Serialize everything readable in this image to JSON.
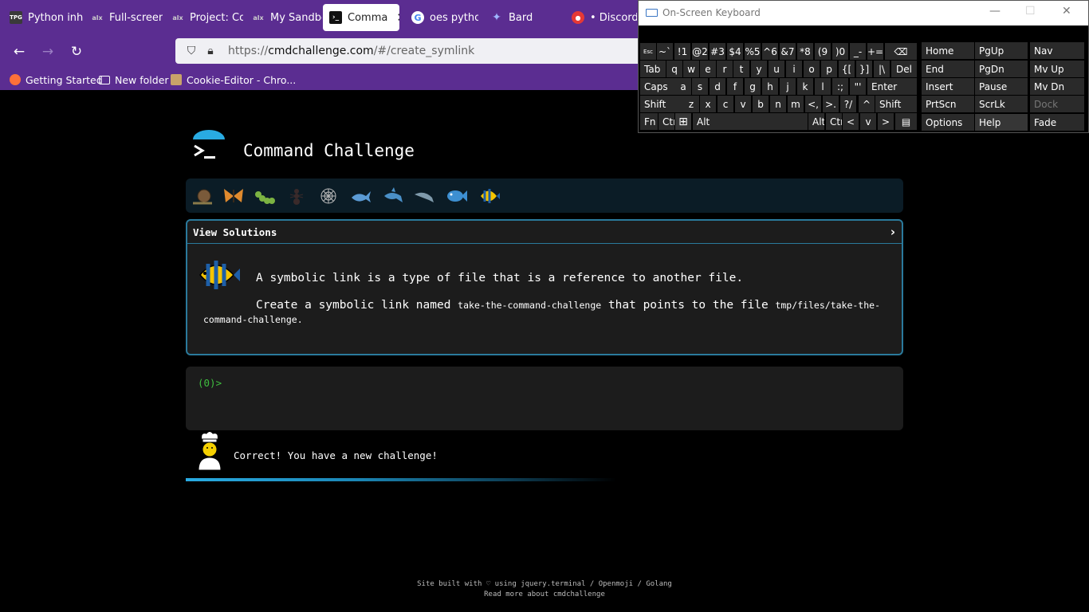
{
  "browser": {
    "tabs": [
      {
        "label": "Python inh",
        "favicon": "TPG"
      },
      {
        "label": "Full-screen",
        "favicon": "alx"
      },
      {
        "label": "Project: Co",
        "favicon": "alx"
      },
      {
        "label": "My Sandbo",
        "favicon": "alx"
      },
      {
        "label": "Comma",
        "favicon": "terminal-icon",
        "active": true,
        "close": "✕"
      },
      {
        "label": "oes python",
        "favicon": "google-icon"
      },
      {
        "label": "Bard",
        "favicon": "bard-icon"
      },
      {
        "label": "• Discord |",
        "favicon": "discord-icon"
      }
    ],
    "url": {
      "scheme": "https://",
      "host": "cmdchallenge.com",
      "path": "/#/create_symlink"
    },
    "bookmarks": [
      "Getting Started",
      "New folder",
      "Cookie-Editor - Chro..."
    ]
  },
  "page": {
    "site_title": "Command Challenge",
    "badges": [
      "snail",
      "butterfly",
      "caterpillar",
      "ant",
      "spider-web",
      "whale",
      "shark",
      "dolphin",
      "fish",
      "tropical-fish"
    ],
    "panel": {
      "header": "View Solutions",
      "arrow": "›",
      "description": "A symbolic link is a type of file that is a reference to another file.",
      "task_prefix": "Create a symbolic link named",
      "task_name": "take-the-command-challenge",
      "task_middle": "that points to the file",
      "task_target": "tmp/files/take-the-command-challenge",
      "task_suffix": "."
    },
    "terminal": {
      "prompt": "(0)>"
    },
    "feedback": "Correct! You have a new challenge!",
    "footer": {
      "line1": "Site built with ♡ using jquery.terminal / Openmoji / Golang",
      "line2": "Read more about cmdchallenge"
    }
  },
  "osk": {
    "title": "On-Screen Keyboard",
    "rows": [
      [
        "Esc",
        "~`",
        "!1",
        "@2",
        "#3",
        "$4",
        "%5",
        "^6",
        "&7",
        "*8",
        "(9",
        ")0",
        "_-",
        "+=",
        "⌫"
      ],
      [
        "Tab",
        "q",
        "w",
        "e",
        "r",
        "t",
        "y",
        "u",
        "i",
        "o",
        "p",
        "{[",
        "}]",
        "|\\",
        "Del"
      ],
      [
        "Caps",
        "a",
        "s",
        "d",
        "f",
        "g",
        "h",
        "j",
        "k",
        "l",
        ":;",
        "\"'",
        "Enter"
      ],
      [
        "Shift",
        "z",
        "x",
        "c",
        "v",
        "b",
        "n",
        "m",
        "<,",
        ">.",
        "?/",
        "^",
        "Shift"
      ],
      [
        "Fn",
        "Ctrl",
        "⊞",
        "Alt",
        "",
        "Alt",
        "Ctrl",
        "<",
        "v",
        ">",
        "▤"
      ]
    ],
    "nav_keys": [
      [
        "Home",
        "PgUp",
        "Nav"
      ],
      [
        "End",
        "PgDn",
        "Mv Up"
      ],
      [
        "Insert",
        "Pause",
        "Mv Dn"
      ],
      [
        "PrtScn",
        "ScrLk",
        "Dock"
      ],
      [
        "Options",
        "Help",
        "Fade"
      ]
    ]
  },
  "colors": {
    "chrome": "#5b2d91",
    "accent": "#2a7a9c",
    "prompt": "#3fbf3f",
    "progress": "#29abe2"
  }
}
